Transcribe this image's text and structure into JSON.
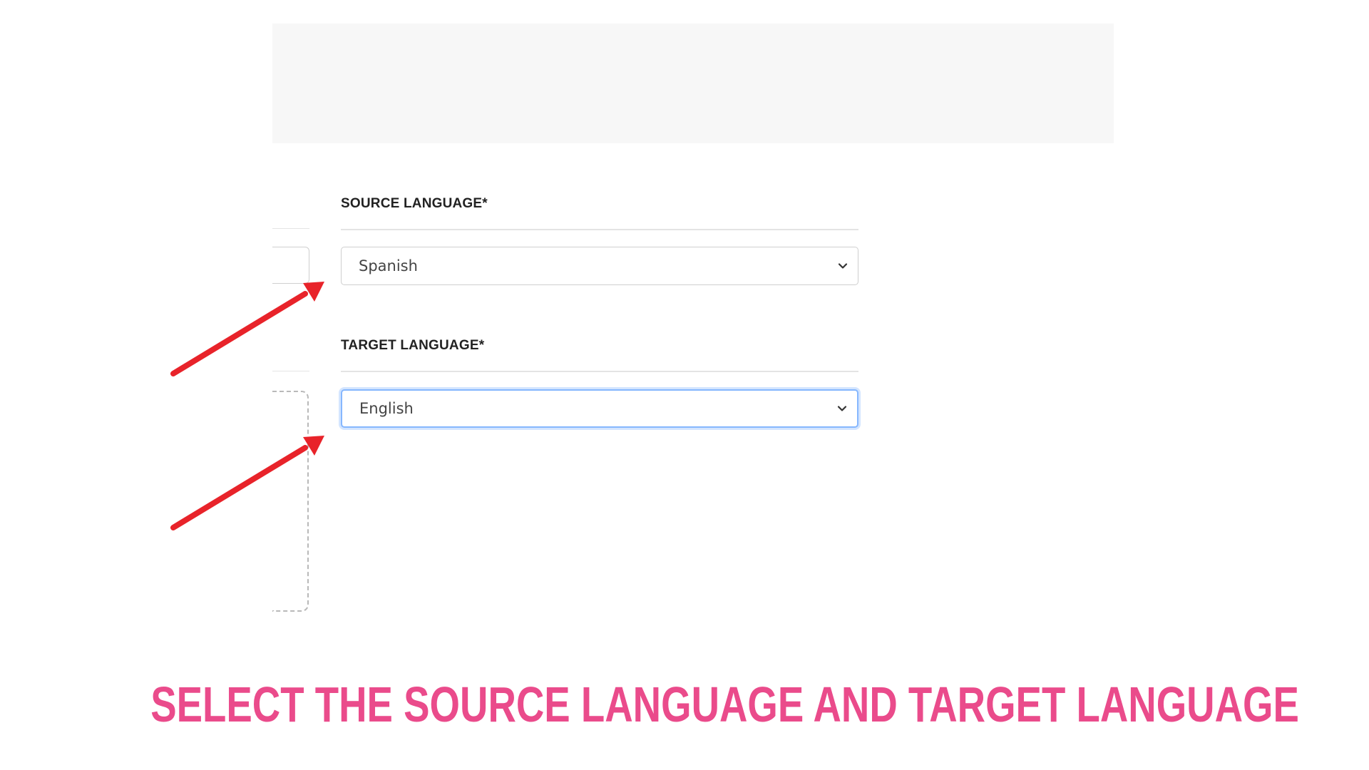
{
  "source_language": {
    "label": "SOURCE LANGUAGE*",
    "selected": "Spanish"
  },
  "target_language": {
    "label": "TARGET LANGUAGE*",
    "selected": "English"
  },
  "caption": {
    "text": "SELECT THE SOURCE LANGUAGE AND TARGET LANGUAGE"
  },
  "colors": {
    "arrow": "#e8232a",
    "caption": "#ea4b8b",
    "focus_border": "#86b7fe"
  },
  "icons": {
    "select_chevron": "chevron-down-icon",
    "annotation_arrow": "arrow-icon"
  }
}
